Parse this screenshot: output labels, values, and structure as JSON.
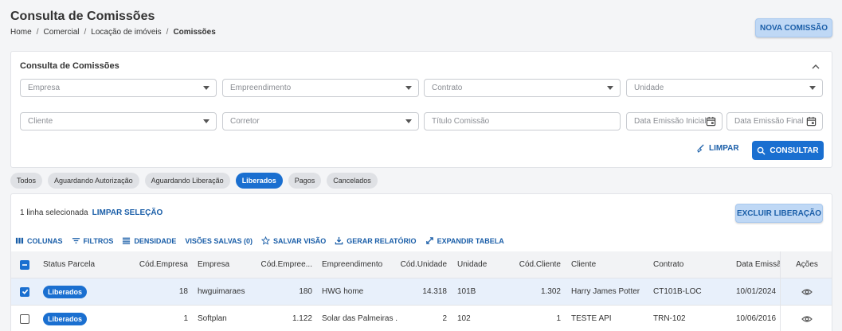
{
  "header": {
    "title": "Consulta de Comissões",
    "breadcrumb": [
      "Home",
      "Comercial",
      "Locação de imóveis",
      "Comissões"
    ],
    "nova_label": "NOVA COMISSÃO"
  },
  "filter": {
    "title": "Consulta de Comissões",
    "empresa": "Empresa",
    "empreendimento": "Empreendimento",
    "contrato": "Contrato",
    "unidade": "Unidade",
    "cliente": "Cliente",
    "corretor": "Corretor",
    "titulo": "Título Comissão",
    "data_inicial": "Data Emissão Inicial",
    "data_final": "Data Emissão Final",
    "limpar_label": "LIMPAR",
    "consultar_label": "CONSULTAR"
  },
  "tabs": [
    "Todos",
    "Aguardando Autorização",
    "Aguardando Liberação",
    "Liberados",
    "Pagos",
    "Cancelados"
  ],
  "active_tab": "Liberados",
  "table": {
    "selection_text": "1 linha selecionada",
    "clear_selection": "LIMPAR SELEÇÃO",
    "excluir_label": "EXCLUIR LIBERAÇÃO",
    "toolbar": {
      "colunas": "COLUNAS",
      "filtros": "FILTROS",
      "densidade": "DENSIDADE",
      "visoes": "VISÕES SALVAS (0)",
      "salvar": "SALVAR VISÃO",
      "relatorio": "GERAR RELATÓRIO",
      "expandir": "EXPANDIR TABELA"
    },
    "headers": {
      "status": "Status Parcela",
      "cod_empresa": "Cód.Empresa",
      "empresa": "Empresa",
      "cod_empreend": "Cód.Empree...",
      "empreendimento": "Empreendimento",
      "cod_unidade": "Cód.Unidade",
      "unidade": "Unidade",
      "cod_cliente": "Cód.Cliente",
      "cliente": "Cliente",
      "contrato": "Contrato",
      "data": "Data Emissão",
      "acoes": "Ações"
    },
    "rows": [
      {
        "status": "Liberados",
        "cod_empresa": "18",
        "empresa": "hwguimaraes",
        "cod_empreend": "180",
        "empreendimento": "HWG home",
        "cod_unidade": "14.318",
        "unidade": "101B",
        "cod_cliente": "1.302",
        "cliente": "Harry James Potter",
        "contrato": "CT101B-LOC",
        "data": "10/01/2024"
      },
      {
        "status": "Liberados",
        "cod_empresa": "1",
        "empresa": "Softplan",
        "cod_empreend": "1.122",
        "empreendimento": "Solar das Palmeiras ...",
        "cod_unidade": "2",
        "unidade": "102",
        "cod_cliente": "1",
        "cliente": "TESTE API",
        "contrato": "TRN-102",
        "data": "10/06/2016"
      }
    ]
  },
  "colors": {
    "primary": "#1a6fd0",
    "primary_light": "#bfd8f5",
    "background": "#f4f5f7"
  }
}
